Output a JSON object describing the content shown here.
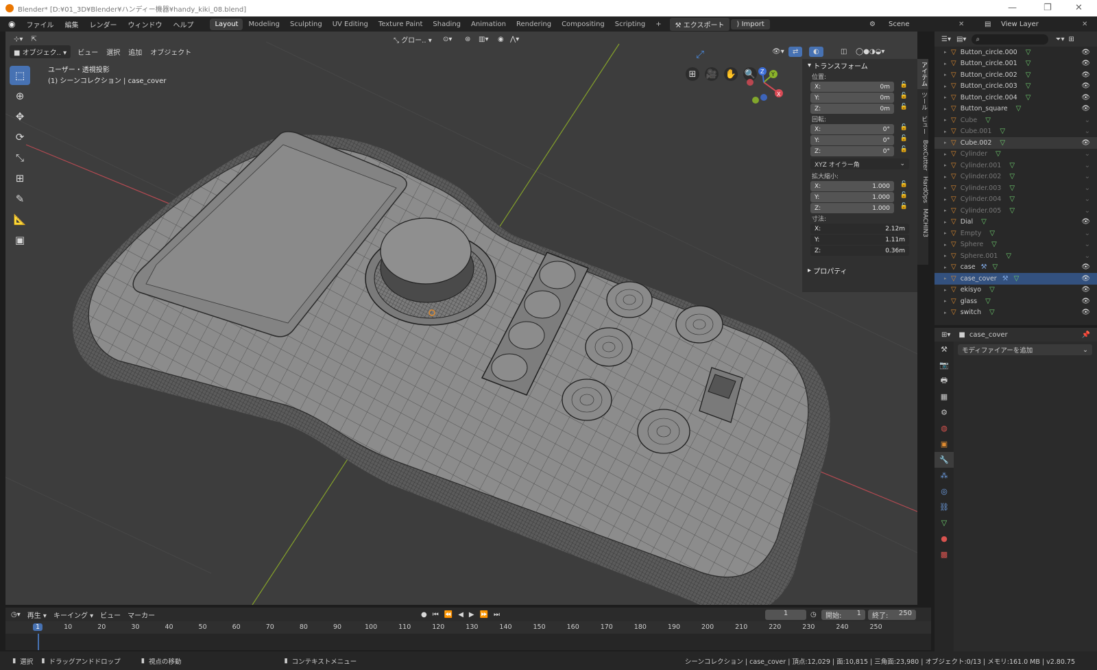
{
  "titlebar": {
    "title": "Blender* [D:¥01_3D¥Blender¥ハンディー機器¥handy_kiki_08.blend]"
  },
  "menu": [
    "ファイル",
    "編集",
    "レンダー",
    "ウィンドウ",
    "ヘルプ"
  ],
  "workspaces": [
    "Layout",
    "Modeling",
    "Sculpting",
    "UV Editing",
    "Texture Paint",
    "Shading",
    "Animation",
    "Rendering",
    "Compositing",
    "Scripting"
  ],
  "active_workspace": "Layout",
  "export_button": "エクスポート",
  "import_button": "Import",
  "scene": "Scene",
  "view_layer": "View Layer",
  "viewport": {
    "mode": "オブジェク..",
    "menus": [
      "ビュー",
      "選択",
      "追加",
      "オブジェクト"
    ],
    "transform_orientation": "グロー..",
    "view_label": "ユーザー・透視投影",
    "collection_label": "(1) シーンコレクション | case_cover"
  },
  "npanel": {
    "transform_title": "トランスフォーム",
    "location_label": "位置:",
    "location": [
      {
        "axis": "X:",
        "value": "0m"
      },
      {
        "axis": "Y:",
        "value": "0m"
      },
      {
        "axis": "Z:",
        "value": "0m"
      }
    ],
    "rotation_label": "回転:",
    "rotation": [
      {
        "axis": "X:",
        "value": "0°"
      },
      {
        "axis": "Y:",
        "value": "0°"
      },
      {
        "axis": "Z:",
        "value": "0°"
      }
    ],
    "rotation_mode": "XYZ オイラー角",
    "scale_label": "拡大縮小:",
    "scale": [
      {
        "axis": "X:",
        "value": "1.000"
      },
      {
        "axis": "Y:",
        "value": "1.000"
      },
      {
        "axis": "Z:",
        "value": "1.000"
      }
    ],
    "dimensions_label": "寸法:",
    "dimensions": [
      {
        "axis": "X:",
        "value": "2.12m"
      },
      {
        "axis": "Y:",
        "value": "1.11m"
      },
      {
        "axis": "Z:",
        "value": "0.36m"
      }
    ],
    "properties_title": "プロパティ"
  },
  "side_tabs": [
    "アイテム",
    "ツール",
    "ビュー",
    "BoxCutter",
    "HardOps",
    "MACHIN3"
  ],
  "outliner": {
    "items": [
      {
        "name": "Button_circle.000",
        "state": "visible"
      },
      {
        "name": "Button_circle.001",
        "state": "visible"
      },
      {
        "name": "Button_circle.002",
        "state": "visible"
      },
      {
        "name": "Button_circle.003",
        "state": "visible"
      },
      {
        "name": "Button_circle.004",
        "state": "visible"
      },
      {
        "name": "Button_square",
        "state": "visible"
      },
      {
        "name": "Cube",
        "state": "hidden"
      },
      {
        "name": "Cube.001",
        "state": "hidden"
      },
      {
        "name": "Cube.002",
        "state": "hovered"
      },
      {
        "name": "Cylinder",
        "state": "hidden"
      },
      {
        "name": "Cylinder.001",
        "state": "hidden"
      },
      {
        "name": "Cylinder.002",
        "state": "hidden"
      },
      {
        "name": "Cylinder.003",
        "state": "hidden"
      },
      {
        "name": "Cylinder.004",
        "state": "hidden"
      },
      {
        "name": "Cylinder.005",
        "state": "hidden"
      },
      {
        "name": "Dial",
        "state": "visible"
      },
      {
        "name": "Empty",
        "state": "hidden"
      },
      {
        "name": "Sphere",
        "state": "hidden"
      },
      {
        "name": "Sphere.001",
        "state": "hidden"
      },
      {
        "name": "case",
        "state": "visible"
      },
      {
        "name": "case_cover",
        "state": "selected"
      },
      {
        "name": "ekisyo",
        "state": "visible"
      },
      {
        "name": "glass",
        "state": "visible"
      },
      {
        "name": "switch",
        "state": "visible"
      }
    ]
  },
  "properties": {
    "object_name": "case_cover",
    "add_modifier": "モディファイアーを追加"
  },
  "timeline": {
    "menus": [
      "再生",
      "キーイング",
      "ビュー",
      "マーカー"
    ],
    "current_frame": "1",
    "start_label": "開始:",
    "start": "1",
    "end_label": "終了:",
    "end": "250",
    "ticks": [
      "1",
      "10",
      "20",
      "30",
      "40",
      "50",
      "60",
      "70",
      "80",
      "90",
      "100",
      "110",
      "120",
      "130",
      "140",
      "150",
      "160",
      "170",
      "180",
      "190",
      "200",
      "210",
      "220",
      "230",
      "240",
      "250"
    ]
  },
  "statusbar": {
    "select": "選択",
    "drag": "ドラッグアンドドロップ",
    "move_view": "視点の移動",
    "context_menu": "コンテキストメニュー",
    "stats": "シーンコレクション | case_cover | 頂点:12,029 | 面:10,815 | 三角面:23,980 | オブジェクト:0/13 | メモリ:161.0 MB | v2.80.75"
  },
  "colors": {
    "accent": "#4772b3",
    "selection": "#33517f",
    "object_orange": "#e08c30",
    "mesh_green": "#6fcf6f",
    "x_axis": "#d94a55",
    "y_axis": "#8ab22a",
    "z_axis": "#3d6ed8"
  }
}
